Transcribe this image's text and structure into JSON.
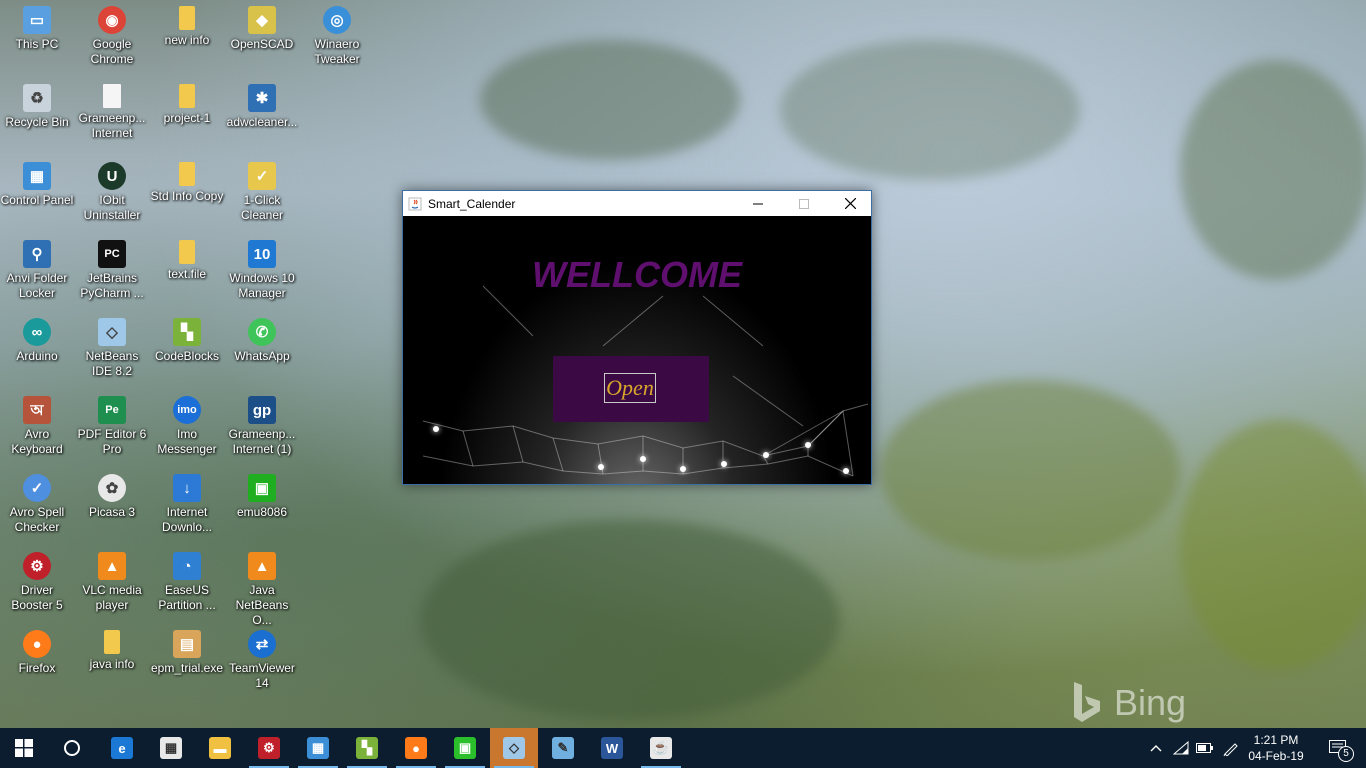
{
  "desktop": {
    "icons": [
      {
        "label": "This PC",
        "icon": "this-pc-icon"
      },
      {
        "label": "Google Chrome",
        "icon": "chrome-icon"
      },
      {
        "label": "new info",
        "icon": "folder-icon"
      },
      {
        "label": "OpenSCAD",
        "icon": "openscad-icon"
      },
      {
        "label": "Winaero Tweaker",
        "icon": "winaero-icon"
      },
      {
        "label": "Recycle Bin",
        "icon": "recycle-bin-icon"
      },
      {
        "label": "Grameenp... Internet",
        "icon": "file-icon"
      },
      {
        "label": "project-1",
        "icon": "folder-icon"
      },
      {
        "label": "adwcleaner...",
        "icon": "adwcleaner-icon"
      },
      {
        "label": "Control Panel",
        "icon": "control-panel-icon"
      },
      {
        "label": "IObit Uninstaller",
        "icon": "iobit-icon"
      },
      {
        "label": "Std Info Copy",
        "icon": "folder-icon"
      },
      {
        "label": "1-Click Cleaner",
        "icon": "cleaner-icon"
      },
      {
        "label": "Anvi Folder Locker",
        "icon": "anvi-icon"
      },
      {
        "label": "JetBrains PyCharm ...",
        "icon": "pycharm-icon"
      },
      {
        "label": "text.file",
        "icon": "folder-icon"
      },
      {
        "label": "Windows 10 Manager",
        "icon": "win10-manager-icon"
      },
      {
        "label": "Arduino",
        "icon": "arduino-icon"
      },
      {
        "label": "NetBeans IDE 8.2",
        "icon": "netbeans-icon"
      },
      {
        "label": "CodeBlocks",
        "icon": "codeblocks-icon"
      },
      {
        "label": "WhatsApp",
        "icon": "whatsapp-icon"
      },
      {
        "label": "Avro Keyboard",
        "icon": "avro-keyboard-icon"
      },
      {
        "label": "PDF Editor 6 Pro",
        "icon": "pdf-editor-icon"
      },
      {
        "label": "Imo Messenger",
        "icon": "imo-icon"
      },
      {
        "label": "Grameenp... Internet (1)",
        "icon": "grameenphone-icon"
      },
      {
        "label": "Avro Spell Checker",
        "icon": "spell-checker-icon"
      },
      {
        "label": "Picasa 3",
        "icon": "picasa-icon"
      },
      {
        "label": "Internet Downlo...",
        "icon": "idm-icon"
      },
      {
        "label": "emu8086",
        "icon": "emu8086-icon"
      },
      {
        "label": "Driver Booster 5",
        "icon": "driver-booster-icon"
      },
      {
        "label": "VLC media player",
        "icon": "vlc-icon"
      },
      {
        "label": "EaseUS Partition ...",
        "icon": "easeus-icon"
      },
      {
        "label": "Java NetBeans O...",
        "icon": "vlc-icon"
      },
      {
        "label": "Firefox",
        "icon": "firefox-icon"
      },
      {
        "label": "java info",
        "icon": "folder-icon"
      },
      {
        "label": "epm_trial.exe",
        "icon": "installer-icon"
      },
      {
        "label": "TeamViewer 14",
        "icon": "teamviewer-icon"
      }
    ]
  },
  "window": {
    "title": "Smart_Calender",
    "welcome_text": "WELLCOME",
    "open_button": "Open"
  },
  "watermark": {
    "text": "Bing"
  },
  "taskbar": {
    "apps": [
      {
        "name": "edge",
        "icon": "edge-icon",
        "color": "#1b78d4"
      },
      {
        "name": "store",
        "icon": "store-icon",
        "color": "#e8e8e8"
      },
      {
        "name": "file-explorer",
        "icon": "folder-icon",
        "color": "#f0c040"
      },
      {
        "name": "driver-booster",
        "icon": "driver-booster-icon",
        "color": "#c0202a"
      },
      {
        "name": "control-panel",
        "icon": "control-panel-icon",
        "color": "#3c8fd6"
      },
      {
        "name": "codeblocks",
        "icon": "codeblocks-icon",
        "color": "#7bb23a"
      },
      {
        "name": "firefox",
        "icon": "firefox-icon",
        "color": "#ff7a18"
      },
      {
        "name": "emu8086",
        "icon": "emu8086-icon",
        "color": "#2bbf2b"
      },
      {
        "name": "netbeans",
        "icon": "netbeans-icon",
        "color": "#9ec7e8"
      },
      {
        "name": "paint",
        "icon": "paint-icon",
        "color": "#6fb0e0"
      },
      {
        "name": "word",
        "icon": "word-icon",
        "color": "#2b579a"
      },
      {
        "name": "java",
        "icon": "java-icon",
        "color": "#e8e8e8"
      }
    ],
    "time": "1:21 PM",
    "date": "04-Feb-19",
    "notification_count": "5"
  }
}
